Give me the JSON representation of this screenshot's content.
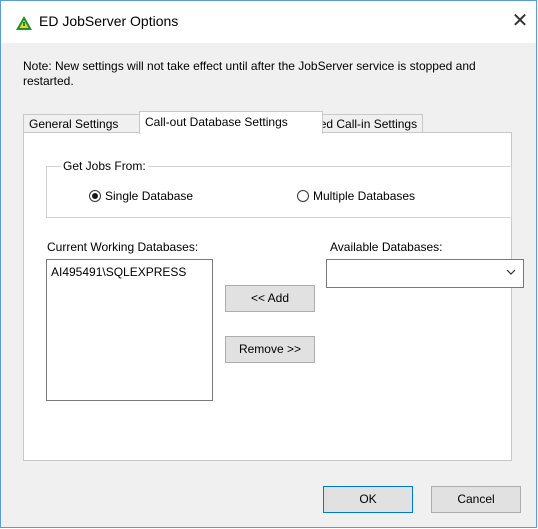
{
  "window": {
    "title": "ED JobServer Options",
    "close_glyph": "✕"
  },
  "note": "Note: New settings will not take effect until after the JobServer service is stopped and restarted.",
  "tabs": [
    {
      "label": "General Settings"
    },
    {
      "label": "Call-out Database Settings",
      "active": true
    },
    {
      "label": "Unscheduled Call-in Settings"
    }
  ],
  "get_jobs": {
    "label": "Get Jobs From:",
    "options": [
      {
        "label": "Single Database",
        "checked": true
      },
      {
        "label": "Multiple Databases",
        "checked": false
      }
    ]
  },
  "current_db": {
    "label": "Current Working Databases:",
    "items": [
      "AI495491\\SQLEXPRESS"
    ]
  },
  "available_db": {
    "label": "Available Databases:",
    "value": ""
  },
  "buttons": {
    "add": "<< Add",
    "remove": "Remove >>",
    "ok": "OK",
    "cancel": "Cancel"
  },
  "colors": {
    "window_border": "#5a9bd8",
    "icon_green": "#1f8f2f",
    "icon_yellow": "#f2d21e"
  }
}
